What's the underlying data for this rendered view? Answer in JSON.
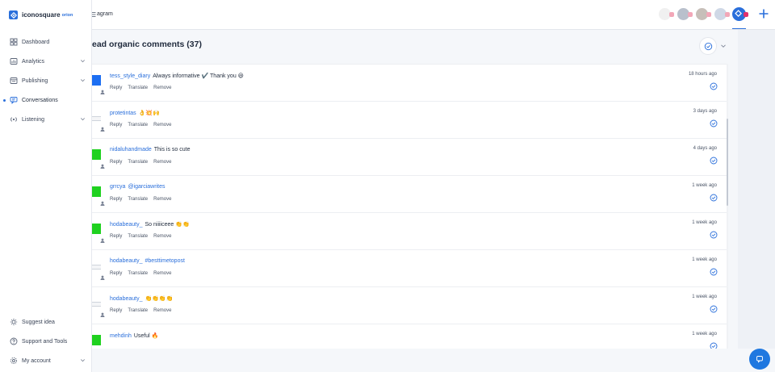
{
  "brand": {
    "name": "iconosquare",
    "tag": "orion"
  },
  "colors": {
    "accent": "#2a6fdb",
    "instagram_badge": "#e1306c"
  },
  "sidebar": {
    "items": [
      {
        "label": "Dashboard",
        "icon": "dashboard-icon",
        "expandable": false
      },
      {
        "label": "Analytics",
        "icon": "analytics-icon",
        "expandable": true
      },
      {
        "label": "Publishing",
        "icon": "publishing-icon",
        "expandable": true
      },
      {
        "label": "Conversations",
        "icon": "conversations-icon",
        "expandable": false,
        "active": true
      },
      {
        "label": "Listening",
        "icon": "listening-icon",
        "expandable": true
      }
    ],
    "bottom": [
      {
        "label": "Suggest idea",
        "icon": "lightbulb-icon"
      },
      {
        "label": "Support and Tools",
        "icon": "help-icon"
      },
      {
        "label": "My account",
        "icon": "gear-icon"
      }
    ]
  },
  "header": {
    "account_name": "agram"
  },
  "panel": {
    "title": "ead organic comments (37)"
  },
  "comments": [
    {
      "user": "tess_style_diary",
      "text": "Always informative ✔️ Thank you 😃",
      "time": "18 hours ago",
      "thumb": "blue"
    },
    {
      "user": "protetintas",
      "text": "👌💥🙌",
      "time": "3 days ago",
      "thumb": "doc"
    },
    {
      "user": "nidaluhandmade",
      "text": "This is so cute",
      "time": "4 days ago",
      "thumb": "green"
    },
    {
      "user": "grrcya",
      "text": "@igarciawrites",
      "time": "1 week ago",
      "thumb": "green"
    },
    {
      "user": "hodabeauty_",
      "text": "So niiiiceee 👏👏",
      "time": "1 week ago",
      "thumb": "green"
    },
    {
      "user": "hodabeauty_",
      "text": "#besttimetopost",
      "time": "1 week ago",
      "thumb": "doc"
    },
    {
      "user": "hodabeauty_",
      "text": "👏👏👏👏",
      "time": "1 week ago",
      "thumb": "doc"
    },
    {
      "user": "mehdinh",
      "text": "Useful 🔥",
      "time": "1 week ago",
      "thumb": "green"
    }
  ],
  "row_actions": {
    "reply": "Reply",
    "translate": "Translate",
    "remove": "Remove"
  }
}
